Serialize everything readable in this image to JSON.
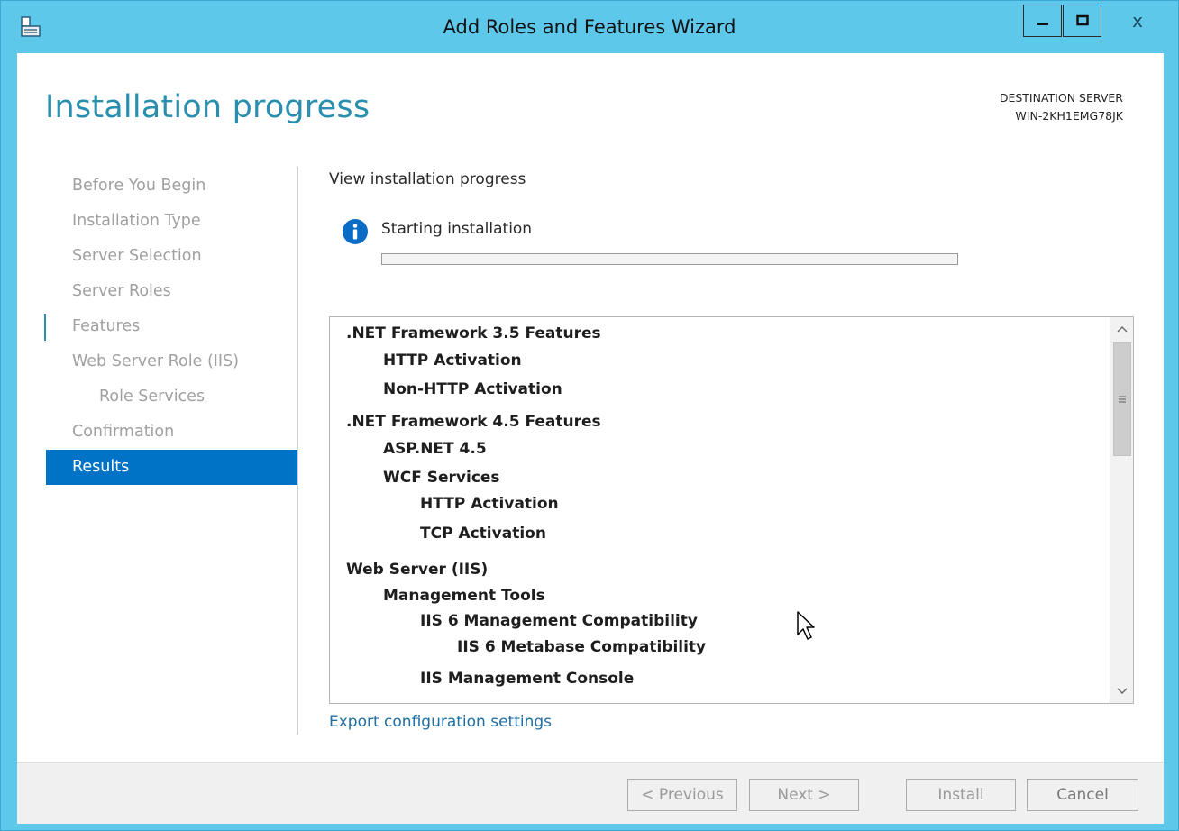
{
  "window": {
    "title": "Add Roles and Features Wizard",
    "close_glyph": "x"
  },
  "header": {
    "page_title": "Installation progress",
    "destination_label": "DESTINATION SERVER",
    "destination_server": "WIN-2KH1EMG78JK"
  },
  "nav": {
    "items": [
      {
        "label": "Before You Begin"
      },
      {
        "label": "Installation Type"
      },
      {
        "label": "Server Selection"
      },
      {
        "label": "Server Roles"
      },
      {
        "label": "Features"
      },
      {
        "label": "Web Server Role (IIS)"
      },
      {
        "label": "Role Services"
      },
      {
        "label": "Confirmation"
      },
      {
        "label": "Results"
      }
    ]
  },
  "main": {
    "section_label": "View installation progress",
    "status_text": "Starting installation",
    "progress": 0,
    "features": [
      {
        "label": ".NET Framework 3.5 Features"
      },
      {
        "label": "HTTP Activation"
      },
      {
        "label": "Non-HTTP Activation"
      },
      {
        "label": ".NET Framework 4.5 Features"
      },
      {
        "label": "ASP.NET 4.5"
      },
      {
        "label": "WCF Services"
      },
      {
        "label": "HTTP Activation"
      },
      {
        "label": "TCP Activation"
      },
      {
        "label": "Web Server (IIS)"
      },
      {
        "label": "Management Tools"
      },
      {
        "label": "IIS 6 Management Compatibility"
      },
      {
        "label": "IIS 6 Metabase Compatibility"
      },
      {
        "label": "IIS Management Console"
      }
    ],
    "export_link": "Export configuration settings"
  },
  "footer": {
    "previous_label": "< Previous",
    "next_label": "Next >",
    "install_label": "Install",
    "cancel_label": "Cancel"
  },
  "colors": {
    "titlebar": "#5ec8ea",
    "accent": "#2a8fae",
    "nav_active": "#0073c6",
    "link": "#1f6fa3",
    "info_icon": "#0a6cc4"
  },
  "icons": {
    "app": "server-manager-icon",
    "status": "info-icon",
    "scroll_grip": "grip-icon"
  }
}
